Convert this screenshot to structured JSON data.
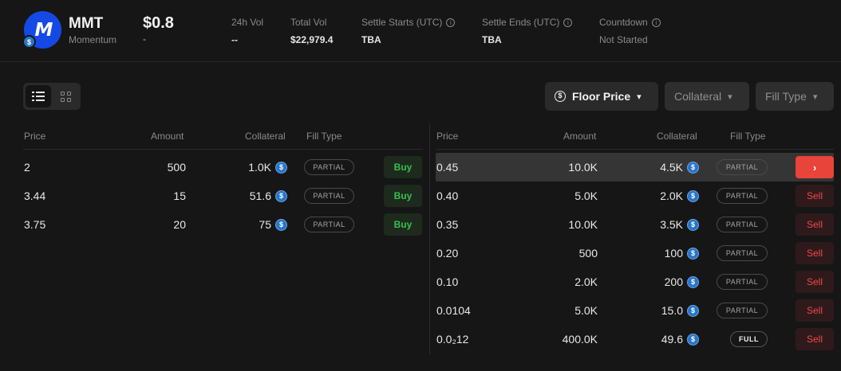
{
  "header": {
    "token_symbol": "MMT",
    "token_name": "Momentum",
    "logo_glyph": "𝙈",
    "price": "$0.8",
    "price_change": "-",
    "stats": [
      {
        "label": "24h Vol",
        "value": "--",
        "info": false
      },
      {
        "label": "Total Vol",
        "value": "$22,979.4",
        "info": false
      },
      {
        "label": "Settle Starts (UTC)",
        "value": "TBA",
        "info": true
      },
      {
        "label": "Settle Ends (UTC)",
        "value": "TBA",
        "info": true
      },
      {
        "label": "Countdown",
        "value": "Not Started",
        "info": true
      }
    ]
  },
  "toolbar": {
    "floor_price_label": "Floor Price",
    "collateral_label": "Collateral",
    "fill_type_label": "Fill Type"
  },
  "columns": {
    "price": "Price",
    "amount": "Amount",
    "collateral": "Collateral",
    "fill_type": "Fill Type"
  },
  "buy_orders": [
    {
      "price": "2",
      "amount": "500",
      "collateral": "1.0K",
      "fill": "PARTIAL",
      "action": "Buy"
    },
    {
      "price": "3.44",
      "amount": "15",
      "collateral": "51.6",
      "fill": "PARTIAL",
      "action": "Buy"
    },
    {
      "price": "3.75",
      "amount": "20",
      "collateral": "75",
      "fill": "PARTIAL",
      "action": "Buy"
    }
  ],
  "sell_orders": [
    {
      "price": "0.45",
      "amount": "10.0K",
      "collateral": "4.5K",
      "fill": "PARTIAL",
      "action": "›"
    },
    {
      "price": "0.40",
      "amount": "5.0K",
      "collateral": "2.0K",
      "fill": "PARTIAL",
      "action": "Sell"
    },
    {
      "price": "0.35",
      "amount": "10.0K",
      "collateral": "3.5K",
      "fill": "PARTIAL",
      "action": "Sell"
    },
    {
      "price": "0.20",
      "amount": "500",
      "collateral": "100",
      "fill": "PARTIAL",
      "action": "Sell"
    },
    {
      "price": "0.10",
      "amount": "2.0K",
      "collateral": "200",
      "fill": "PARTIAL",
      "action": "Sell"
    },
    {
      "price": "0.0104",
      "amount": "5.0K",
      "collateral": "15.0",
      "fill": "PARTIAL",
      "action": "Sell"
    },
    {
      "price": "0.0₂12",
      "amount": "400.0K",
      "collateral": "49.6",
      "fill": "FULL",
      "action": "Sell"
    }
  ],
  "colors": {
    "background": "#161616",
    "buy_green": "#36c14e",
    "sell_red": "#ef4848",
    "usdc_blue": "#2775ca",
    "logo_blue": "#1549e6"
  },
  "icons": {
    "usdc": "usdc-icon",
    "info": "info-icon",
    "chevron": "chevron-down-icon"
  }
}
